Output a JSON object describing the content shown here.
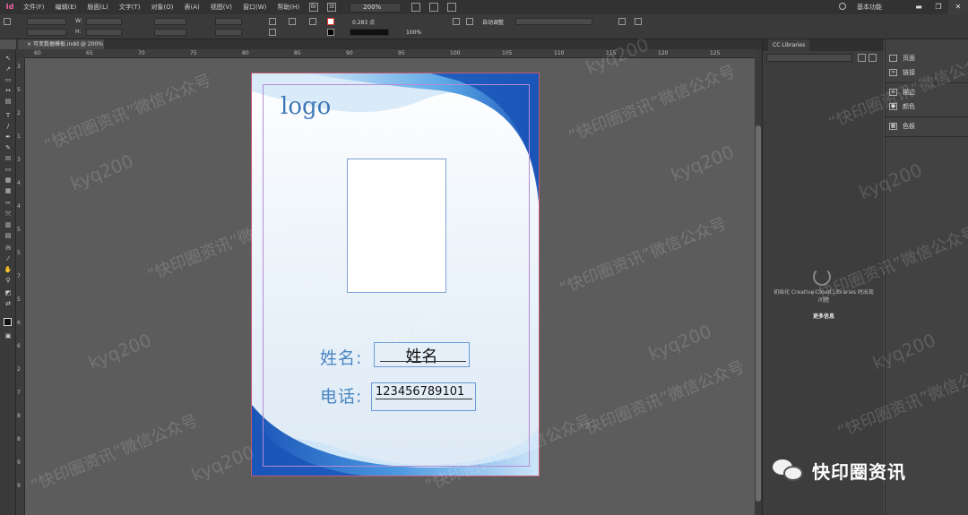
{
  "menubar": {
    "app_logo": "Id",
    "items": [
      "文件(F)",
      "编辑(E)",
      "版面(L)",
      "文字(T)",
      "对象(O)",
      "表(A)",
      "视图(V)",
      "窗口(W)",
      "帮助(H)"
    ],
    "br_label": "Br",
    "st_label": "St",
    "zoom": "200%",
    "workspace": "基本功能",
    "win_min": "▬",
    "win_restore": "❐",
    "win_close": "✕"
  },
  "controlbar": {
    "w_label": "W:",
    "h_label": "H:",
    "stroke_weight": "0.283 点",
    "scale_pct": "100%",
    "auto_fit": "自动调整"
  },
  "tab": {
    "title": "可变数据模板.indd @ 200%",
    "close": "×"
  },
  "ruler": {
    "top_ticks": [
      "60",
      "65",
      "70",
      "75",
      "80",
      "85",
      "90",
      "95",
      "100",
      "105",
      "110",
      "115",
      "120",
      "125"
    ],
    "left_ticks": [
      "3",
      "5",
      "2",
      "1",
      "3",
      "4",
      "4",
      "5",
      "5",
      "7",
      "5",
      "6",
      "6",
      "2",
      "7",
      "8",
      "8",
      "9",
      "9"
    ]
  },
  "page": {
    "logo": "logo",
    "name_label": "姓名:",
    "name_value": "姓名",
    "phone_label": "电话:",
    "phone_value": "123456789101"
  },
  "cc_panel": {
    "tab_label": "CC Libraries",
    "message": "初始化 Creative Cloud Libraries 时出现问题",
    "more_info": "更多信息"
  },
  "dock": {
    "items": [
      {
        "label": "页面",
        "icon": "pages-icon"
      },
      {
        "label": "链接",
        "icon": "links-icon"
      },
      {
        "label": "描边",
        "icon": "stroke-icon"
      },
      {
        "label": "颜色",
        "icon": "color-icon"
      },
      {
        "label": "色板",
        "icon": "swatches-icon"
      }
    ]
  },
  "watermark": {
    "cn": "“快印圈资讯”微信公众号",
    "en": "kyq200"
  },
  "brand": {
    "text": "快印圈资讯"
  },
  "colors": {
    "card_blue_dark": "#1f5fbf",
    "card_blue_light": "#8cc3ee",
    "label_blue": "#4a86c1",
    "logo_blue": "#3f78b6",
    "page_border": "#c45b76"
  }
}
